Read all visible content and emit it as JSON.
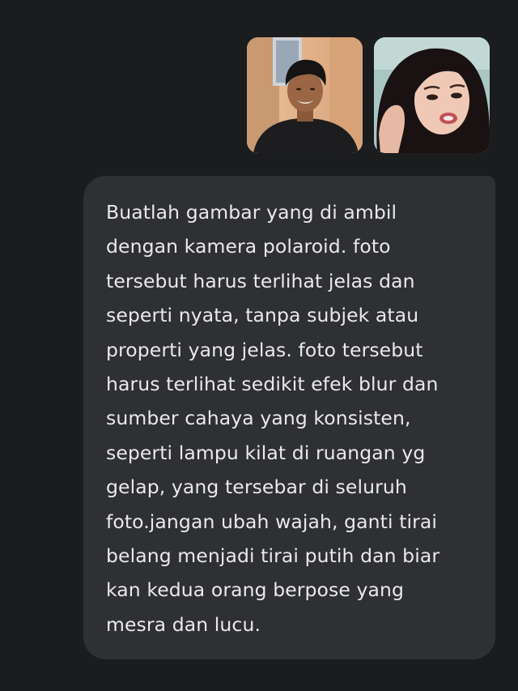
{
  "attachments": [
    {
      "icon": "photo-man-smiling-icon"
    },
    {
      "icon": "photo-woman-selfie-icon"
    }
  ],
  "message": {
    "text": "Buatlah gambar yang di ambil\ndengan kamera polaroid. foto\ntersebut harus terlihat jelas dan\nseperti nyata, tanpa subjek atau\nproperti yang jelas. foto tersebut\nharus terlihat sedikit efek blur dan\nsumber cahaya yang konsisten,\nseperti lampu kilat di ruangan yg\ngelap, yang tersebar di seluruh\nfoto.jangan ubah wajah, ganti tirai\nbelang menjadi tirai putih dan biar\nkan kedua orang berpose yang\nmesra dan lucu."
  },
  "colors": {
    "background": "#1b1c1e",
    "bubble": "#2f3033",
    "text": "#e9e9ea"
  }
}
